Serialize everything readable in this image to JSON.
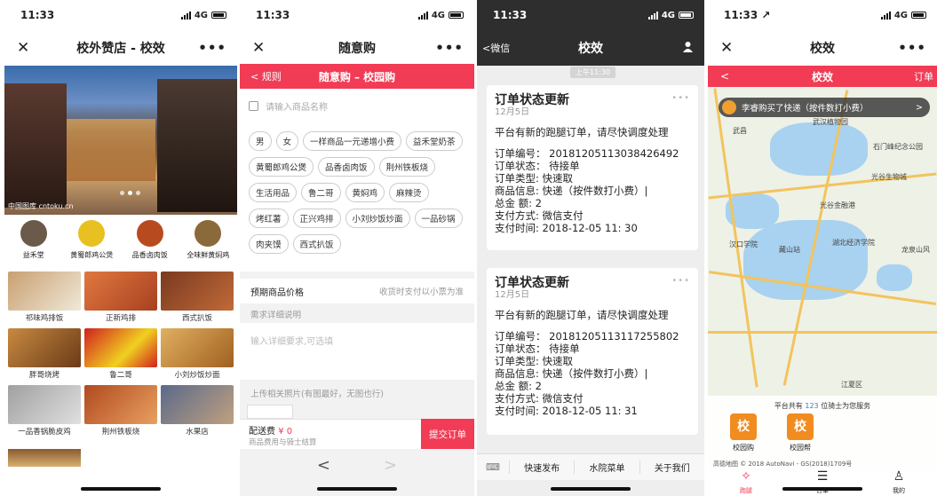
{
  "p1": {
    "time": "11:33",
    "net": "4G",
    "title": "校外赞店 - 校效",
    "close": "✕",
    "more": "•••",
    "watermark": "中国图库 cntoku.cn",
    "cats": [
      {
        "label": "益禾堂",
        "color": "#6b5a4a"
      },
      {
        "label": "黄蜀郎鸡公煲",
        "color": "#e8c020"
      },
      {
        "label": "品香卤肉饭",
        "color": "#b84a20"
      },
      {
        "label": "全味鲜黄焖鸡",
        "color": "#8a6a3a"
      }
    ],
    "items": [
      {
        "label": "祁味鸡排饭",
        "color": "#d8c8a0"
      },
      {
        "label": "正新鸡排",
        "color": "#e07840"
      },
      {
        "label": "西式扒饭",
        "color": "#b05a30"
      },
      {
        "label": "胖哥烧烤",
        "color": "#a86a30"
      },
      {
        "label": "鲁二哥",
        "color": "#d02020"
      },
      {
        "label": "小刘炒饭炒面",
        "color": "#c89040"
      },
      {
        "label": "一品香锅脆皮鸡",
        "color": "#8a8a8a"
      },
      {
        "label": "荆州铁板烧",
        "color": "#b04a20"
      },
      {
        "label": "水果店",
        "color": "#6a7a9a"
      }
    ]
  },
  "p2": {
    "time": "11:33",
    "net": "4G",
    "title": "随意购",
    "close": "✕",
    "more": "•••",
    "back": "< 规则",
    "banner": "随意购 – 校园购",
    "search_placeholder": "请输入商品名称",
    "tags": [
      "男",
      "女",
      "一样商品一元递增小费",
      "益禾堂奶茶",
      "黄蜀郎鸡公煲",
      "品香卤肉饭",
      "荆州铁板烧",
      "生活用品",
      "鲁二哥",
      "黄焖鸡",
      "麻辣烫",
      "烤红薯",
      "正兴鸡排",
      "小刘炒饭炒面",
      "一品砂锅",
      "肉夹馍",
      "西式扒饭"
    ],
    "price_label": "预期商品价格",
    "price_hint": "收货时支付以小票为准",
    "detail_label": "需求详细说明",
    "detail_placeholder": "输入详细要求,可选填",
    "photo_label": "上传相关照片(有图最好，无图也行)",
    "fee_label": "配送费",
    "fee_value": "¥ 0",
    "fee_note": "商品费用与骑士结算",
    "submit": "提交订单",
    "prev": "<",
    "next": ">"
  },
  "p3": {
    "time": "11:33",
    "net": "4G",
    "back": "<微信",
    "title": "校效",
    "stamp": "上午11:30",
    "msgs": [
      {
        "title": "订单状态更新",
        "date": "12月5日",
        "lines": [
          "平台有新的跑腿订单，请尽快调度处理",
          "",
          "订单编号： 20181205113038426492",
          "订单状态： 待接单",
          "订单类型: 快速取",
          "商品信息: 快递（按件数打小费）|",
          "总金  额: 2",
          "支付方式: 微信支付",
          "支付时间: 2018-12-05 11: 30"
        ]
      },
      {
        "title": "订单状态更新",
        "date": "12月5日",
        "lines": [
          "平台有新的跑腿订单，请尽快调度处理",
          "",
          "订单编号： 20181205113117255802",
          "订单状态： 待接单",
          "订单类型: 快速取",
          "商品信息: 快递（按件数打小费）|",
          "总金  额: 2",
          "支付方式: 微信支付",
          "支付时间: 2018-12-05 11: 31"
        ]
      }
    ],
    "menu": [
      "快速发布",
      "水院菜单",
      "关于我们"
    ],
    "kb": "⌨"
  },
  "p4": {
    "time": "11:33 ↗",
    "net": "4G",
    "title": "校效",
    "close": "✕",
    "more": "•••",
    "back": "<",
    "banner": "校效",
    "right": "订单",
    "toast": "李睿购买了快递（按件数打小费）",
    "toast_arrow": ">",
    "places": [
      "武汉植物园",
      "武昌",
      "石门峰纪念公园",
      "光谷生物城",
      "光谷金融港",
      "汉口学院",
      "藏山站",
      "湖北经济学院",
      "龙泉山风",
      "江夏区"
    ],
    "info_pre": "平台共有",
    "info_num": "123",
    "info_post": "位骑士为您服务",
    "btns": [
      "校园购",
      "校园帮"
    ],
    "copyright": "高德地图 © 2018 AutoNavi - GS(2018)1709号",
    "tabs": [
      {
        "icon": "✧",
        "label": "跑腿"
      },
      {
        "icon": "☰",
        "label": "订单"
      },
      {
        "icon": "♙",
        "label": "我的"
      }
    ]
  }
}
